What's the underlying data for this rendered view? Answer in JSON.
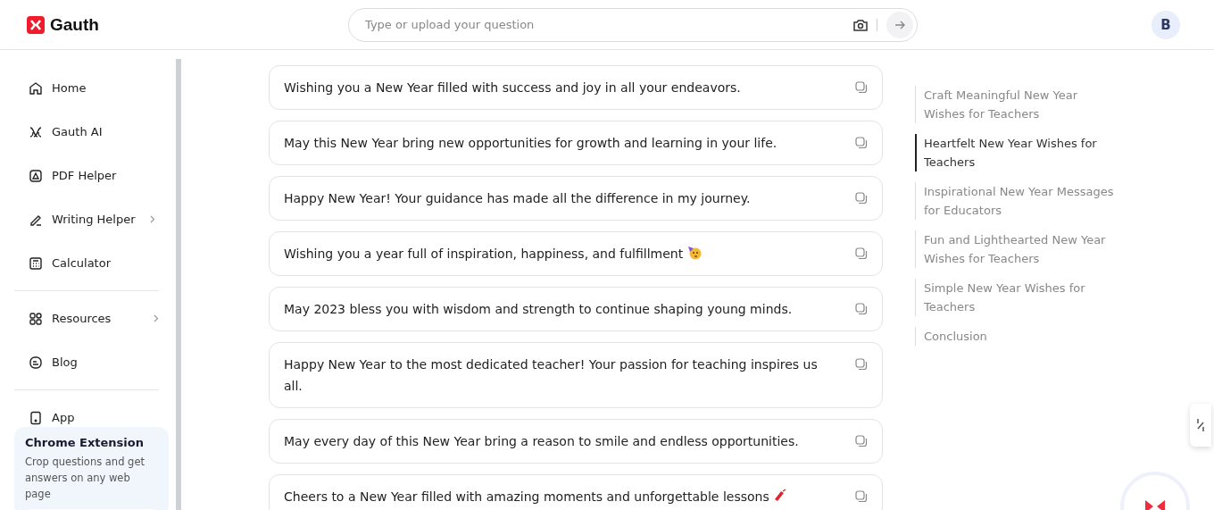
{
  "header": {
    "logo_text": "Gauth",
    "search": {
      "placeholder": "Type or upload your question"
    },
    "avatar": "B"
  },
  "sidebar": {
    "groups": [
      {
        "items": [
          {
            "label": "Home",
            "has_submenu": false
          },
          {
            "label": "Gauth AI",
            "has_submenu": false
          },
          {
            "label": "PDF Helper",
            "has_submenu": false
          },
          {
            "label": "Writing Helper",
            "has_submenu": true
          },
          {
            "label": "Calculator",
            "has_submenu": false
          }
        ]
      },
      {
        "items": [
          {
            "label": "Resources",
            "has_submenu": true
          },
          {
            "label": "Blog",
            "has_submenu": false
          }
        ]
      },
      {
        "items": [
          {
            "label": "App",
            "has_submenu": false
          }
        ]
      }
    ],
    "promo": {
      "title": "Chrome Extension",
      "text": "Crop questions and get answers on any web page"
    }
  },
  "wishes": [
    {
      "kind": "plain",
      "text": "Wishing you a New Year filled with success and joy in all your endeavors."
    },
    {
      "kind": "plain",
      "text": "May this New Year bring new opportunities for growth and learning in your life."
    },
    {
      "kind": "plain",
      "text": "Happy New Year! Your guidance has made all the difference in my journey."
    },
    {
      "kind": "party",
      "text": "Wishing you a year full of inspiration, happiness, and fulfillment"
    },
    {
      "kind": "plain",
      "text": "May 2023 bless you with wisdom and strength to continue shaping young minds."
    },
    {
      "kind": "plain",
      "text": "Happy New Year to the most dedicated teacher! Your passion for teaching inspires us all."
    },
    {
      "kind": "plain",
      "text": "May every day of this New Year bring a reason to smile and endless opportunities."
    },
    {
      "kind": "firecracker",
      "text": "Cheers to a New Year filled with amazing moments and unforgettable lessons"
    }
  ],
  "toc": [
    {
      "label": "Craft Meaningful New Year Wishes for Teachers",
      "selected": false
    },
    {
      "label": "Heartfelt New Year Wishes for Teachers",
      "selected": true
    },
    {
      "label": "Inspirational New Year Messages for Educators",
      "selected": false
    },
    {
      "label": "Fun and Lighthearted New Year Wishes for Teachers",
      "selected": false
    },
    {
      "label": "Simple New Year Wishes for Teachers",
      "selected": false
    },
    {
      "label": "Conclusion",
      "selected": false
    }
  ]
}
